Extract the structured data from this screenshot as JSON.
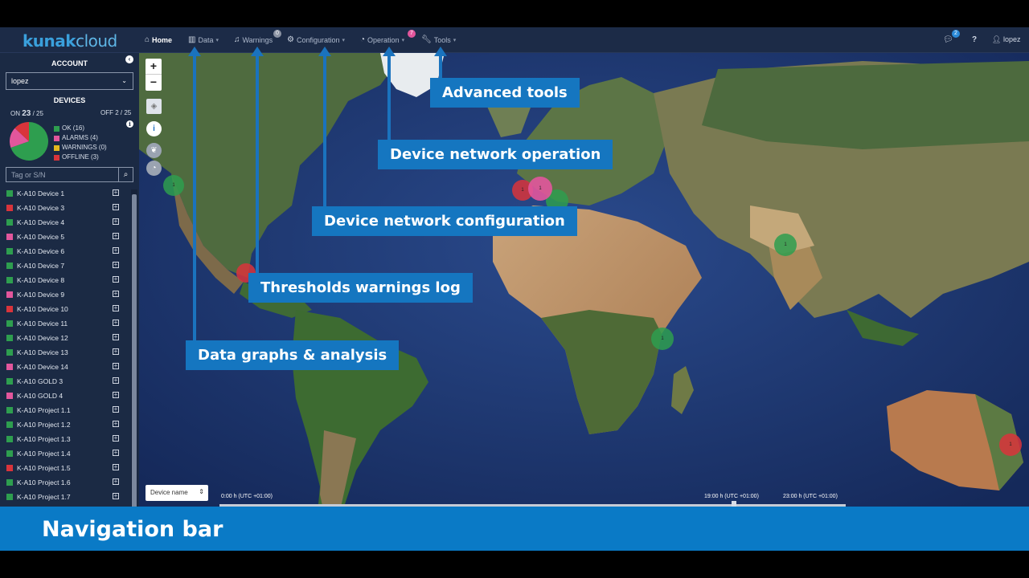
{
  "brand": {
    "name": "kunak",
    "suffix": "cloud"
  },
  "nav": {
    "items": [
      {
        "label": "Home",
        "icon": "home-icon"
      },
      {
        "label": "Data",
        "icon": "bar-chart-icon"
      },
      {
        "label": "Warnings",
        "icon": "bell-icon",
        "badge": "0"
      },
      {
        "label": "Configuration",
        "icon": "cogs-icon"
      },
      {
        "label": "Operation",
        "icon": "gauge-icon",
        "badge": "7"
      },
      {
        "label": "Tools",
        "icon": "wrench-icon"
      }
    ],
    "messages_badge": "2",
    "help": "?",
    "user": "lopez"
  },
  "sidebar": {
    "account_title": "ACCOUNT",
    "account_value": "lopez",
    "devices_title": "DEVICES",
    "on_label": "ON",
    "on_count": "23",
    "on_total": "/ 25",
    "off_label": "OFF 2 / 25",
    "legend": [
      {
        "label": "OK (16)",
        "color": "#2e9e4f",
        "value": 16
      },
      {
        "label": "ALARMS (4)",
        "color": "#e2569c",
        "value": 4
      },
      {
        "label": "WARNINGS (0)",
        "color": "#e6b81e",
        "value": 0
      },
      {
        "label": "OFFLINE (3)",
        "color": "#d9343b",
        "value": 3
      }
    ],
    "search_placeholder": "Tag or S/N",
    "devices": [
      {
        "name": "K-A10 Device 1",
        "color": "#2e9e4f"
      },
      {
        "name": "K-A10 Device 3",
        "color": "#d9343b"
      },
      {
        "name": "K-A10 Device 4",
        "color": "#2e9e4f"
      },
      {
        "name": "K-A10 Device 5",
        "color": "#e2569c"
      },
      {
        "name": "K-A10 Device 6",
        "color": "#2e9e4f"
      },
      {
        "name": "K-A10 Device 7",
        "color": "#2e9e4f"
      },
      {
        "name": "K-A10 Device 8",
        "color": "#2e9e4f"
      },
      {
        "name": "K-A10 Device 9",
        "color": "#e2569c"
      },
      {
        "name": "K-A10 Device 10",
        "color": "#d9343b"
      },
      {
        "name": "K-A10 Device 11",
        "color": "#2e9e4f"
      },
      {
        "name": "K-A10 Device 12",
        "color": "#2e9e4f"
      },
      {
        "name": "K-A10 Device 13",
        "color": "#2e9e4f"
      },
      {
        "name": "K-A10 Device 14",
        "color": "#e2569c"
      },
      {
        "name": "K-A10 GOLD 3",
        "color": "#2e9e4f"
      },
      {
        "name": "K-A10 GOLD 4",
        "color": "#e2569c"
      },
      {
        "name": "K-A10 Project 1.1",
        "color": "#2e9e4f"
      },
      {
        "name": "K-A10 Project 1.2",
        "color": "#2e9e4f"
      },
      {
        "name": "K-A10 Project 1.3",
        "color": "#2e9e4f"
      },
      {
        "name": "K-A10 Project 1.4",
        "color": "#2e9e4f"
      },
      {
        "name": "K-A10 Project 1.5",
        "color": "#d9343b"
      },
      {
        "name": "K-A10 Project 1.6",
        "color": "#2e9e4f"
      },
      {
        "name": "K-A10 Project 1.7",
        "color": "#2e9e4f"
      }
    ]
  },
  "map": {
    "sort_label": "Device name",
    "timeline_start": "0:00 h (UTC +01:00)",
    "timeline_mid": "19:00 h (UTC +01:00)",
    "timeline_end": "23:00 h (UTC +01:00)",
    "cluster_label": "1"
  },
  "callouts": {
    "advanced_tools": "Advanced tools",
    "device_network_operation": "Device network operation",
    "device_network_configuration": "Device network configuration",
    "thresholds_warnings_log": "Thresholds warnings log",
    "data_graphs_analysis": "Data graphs & analysis"
  },
  "footer_title": "Navigation bar"
}
